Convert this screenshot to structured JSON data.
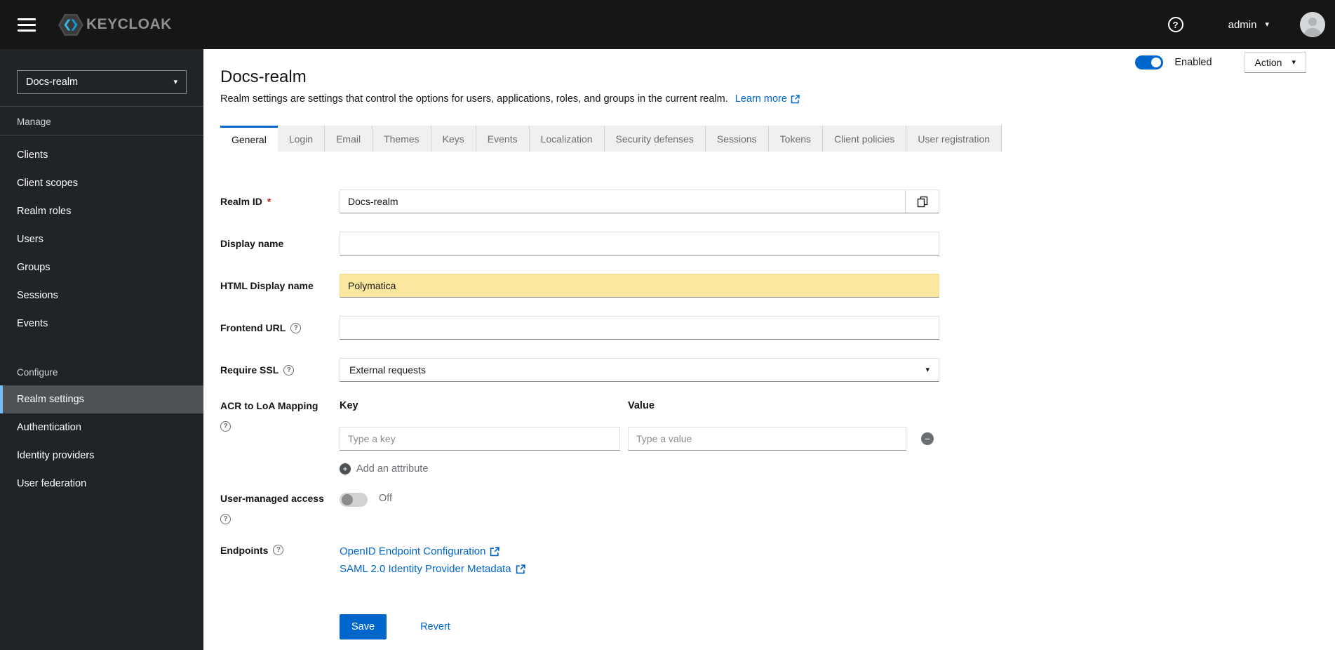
{
  "topbar": {
    "brand": "KEYCLOAK",
    "username": "admin"
  },
  "icons": {
    "help": "?",
    "caret_down": "▾",
    "minus": "−",
    "plus": "+",
    "required": "*"
  },
  "sidebar": {
    "realm_selector": "Docs-realm",
    "manage": {
      "title": "Manage",
      "items": [
        "Clients",
        "Client scopes",
        "Realm roles",
        "Users",
        "Groups",
        "Sessions",
        "Events"
      ]
    },
    "configure": {
      "title": "Configure",
      "items": [
        "Realm settings",
        "Authentication",
        "Identity providers",
        "User federation"
      ]
    }
  },
  "header": {
    "title": "Docs-realm",
    "description": "Realm settings are settings that control the options for users, applications, roles, and groups in the current realm.",
    "learn_more": "Learn more",
    "enabled_label": "Enabled",
    "action_label": "Action"
  },
  "tabs": [
    "General",
    "Login",
    "Email",
    "Themes",
    "Keys",
    "Events",
    "Localization",
    "Security defenses",
    "Sessions",
    "Tokens",
    "Client policies",
    "User registration"
  ],
  "active_tab": "General",
  "form": {
    "realm_id": {
      "label": "Realm ID",
      "value": "Docs-realm"
    },
    "display_name": {
      "label": "Display name",
      "value": ""
    },
    "html_display_name": {
      "label": "HTML Display name",
      "value": "Polymatica"
    },
    "frontend_url": {
      "label": "Frontend URL",
      "value": ""
    },
    "require_ssl": {
      "label": "Require SSL",
      "value": "External requests"
    },
    "acr_loa": {
      "label": "ACR to LoA Mapping",
      "key_header": "Key",
      "value_header": "Value",
      "key_placeholder": "Type a key",
      "value_placeholder": "Type a value",
      "add_label": "Add an attribute"
    },
    "user_managed_access": {
      "label": "User-managed access",
      "state": "Off"
    },
    "endpoints": {
      "label": "Endpoints",
      "links": [
        "OpenID Endpoint Configuration",
        "SAML 2.0 Identity Provider Metadata"
      ]
    },
    "save_label": "Save",
    "revert_label": "Revert"
  },
  "colors": {
    "accent": "#0066cc",
    "topbar_bg": "#161616",
    "sidebar_bg": "#212427",
    "selected_nav_bg": "#4f5255",
    "selected_nav_border": "#73bcf7",
    "highlight_bg": "#fce79e",
    "link": "#0066cc",
    "danger": "#c9190b"
  }
}
